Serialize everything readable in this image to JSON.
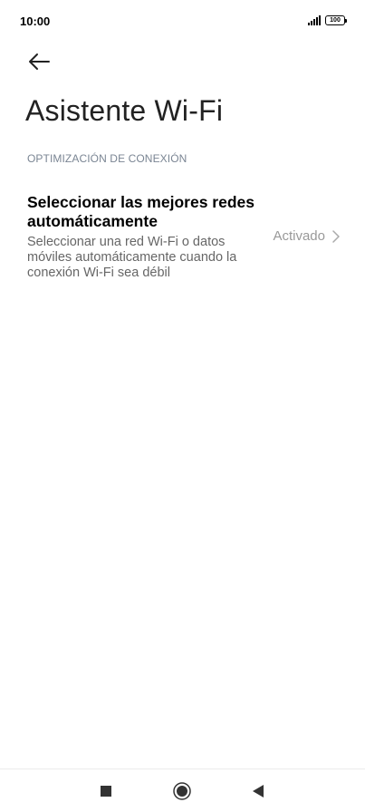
{
  "status_bar": {
    "time": "10:00",
    "battery": "100",
    "icons": [
      "signal-icon",
      "battery-icon"
    ]
  },
  "header": {
    "back_icon": "arrow-left-icon",
    "title": "Asistente Wi-Fi"
  },
  "section": {
    "header": "OPTIMIZACIÓN DE CONEXIÓN"
  },
  "setting": {
    "title": "Seleccionar las mejores redes automáticamente",
    "summary": "Seleccionar una red Wi-Fi o datos móviles automáticamente cuando la conexión Wi-Fi sea débil",
    "value": "Activado",
    "chevron_icon": "chevron-right-icon"
  },
  "nav_bar": {
    "icons": [
      "recents-square-icon",
      "home-circle-icon",
      "back-triangle-icon"
    ]
  },
  "colors": {
    "background": "#ffffff",
    "section_header": "#7a8593",
    "secondary_text": "#666666",
    "value_text": "#999999"
  }
}
